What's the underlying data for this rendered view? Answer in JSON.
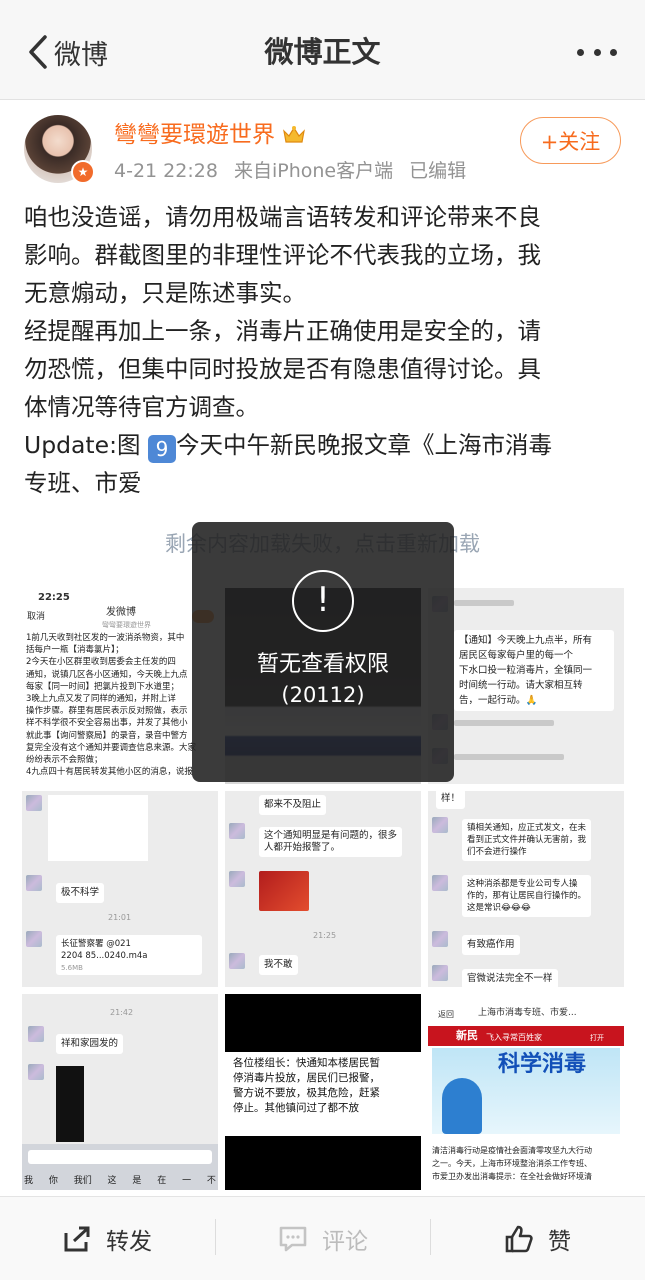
{
  "nav": {
    "back_label": "微博",
    "title": "微博正文"
  },
  "author": {
    "name": "彎彎要環遊世界",
    "date": "4-21 22:28",
    "source": "来自iPhone客户端",
    "edited": "已编辑"
  },
  "follow_label": "+关注",
  "post": {
    "lines": [
      "咱也没造谣，请勿用极端言语转发和评论带来不良",
      "影响。群截图里的非理性评论不代表我的立场，我",
      "无意煽动，只是陈述事实。",
      "经提醒再加上一条，消毒片正确使用是安全的，请",
      "勿恐慌，但集中同时投放是否有隐患值得讨论。具",
      "体情况等待官方调查。"
    ],
    "update_prefix": "Update:图 ",
    "update_num": "9",
    "update_rest": "今天中午新民晚报文章《上海市消毒",
    "last_line": "专班、市爱"
  },
  "load_fail": "剩余内容加载失败，点击重新加载",
  "error": {
    "icon": "!",
    "message": "暂无查看权限",
    "code": "(20112)"
  },
  "images": {
    "img1": {
      "time": "22:25",
      "cancel": "取消",
      "title": "发微博",
      "subtitle": "彎彎要環遊世界",
      "lines": [
        "1前几天收到社区发的一波消杀物资，其中",
        "括每户一瓶【消毒氯片】；",
        "2今天在小区群里收到居委会主任发的四",
        "通知，说镇几区各小区通知，今天晚上九点",
        "每家【同一时间】把氯片投到下水道里；",
        "3晚上九点又发了同样的通知，并附上详",
        "操作步骤。群里有居民表示反对照做，表示",
        "样不科学很不安全容易出事，并发了其他小",
        "就此事【询问警察局】的录音，录音中警方",
        "复完全没有这个通知并要调查信息来源。大家",
        "纷纷表示不会照做；",
        "4九点四十有居民转发其他小区的消息，说报"
      ]
    },
    "img3": {
      "lines": [
        "【通知】今天晚上九点半，所有",
        "居民区每家每户里的每一个",
        "下水口投一粒消毒片，全镇同一",
        "时间统一行动。请大家相互转",
        "告，一起行动。🙏"
      ]
    },
    "img4": {
      "msg1": "极不科学",
      "time": "21:01",
      "file": "长征警察署 @021",
      "file2": "2204 85...0240.m4a",
      "size": "5.6MB"
    },
    "img5": {
      "msg0": "都来不及阻止",
      "msg1": "这个通知明显是有问题的，很多",
      "msg2": "人都开始报警了。",
      "time": "21:25",
      "msg3": "我不敢"
    },
    "img6": {
      "msg0": "样！",
      "msg1": "镇相关通知，应正式发文，在未",
      "msg2": "看到正式文件并确认无害前，我",
      "msg3": "们不会进行操作",
      "msg4": "这种消杀都是专业公司专人操",
      "msg5": "作的，那有让居民自行操作的。",
      "msg6": "这是常识😂😂😂",
      "msg7": "有致癌作用",
      "msg8": "官微说法完全不一样"
    },
    "img7": {
      "time": "21:42",
      "msg1": "祥和家园发的",
      "keys": [
        "我",
        "你",
        "我们",
        "这",
        "是",
        "在",
        "一",
        "不"
      ]
    },
    "img8": {
      "lines": [
        "各位楼组长：快通知本楼居民暂",
        "停消毒片投放，居民们已报警，",
        "警方说不要放，极其危险，赶紧",
        "停止。其他镇问过了都不放"
      ]
    },
    "img9": {
      "back": "返回",
      "title": "上海市消毒专班、市爱...",
      "brand": "新民",
      "brand_sub": "飞入寻常百姓家",
      "open": "打开",
      "banner": "科学消毒",
      "text1": "清洁消毒行动是疫情社会面清零攻坚九大行动",
      "text2": "之一。今天，上海市环境整治消杀工作专班、",
      "text3": "市爱卫办发出消毒提示：在全社会做好环境清"
    }
  },
  "actions": {
    "repost": "转发",
    "comment": "评论",
    "like": "赞"
  },
  "colors": {
    "accent": "#f86b1e",
    "link_blue": "#4e88d6"
  }
}
